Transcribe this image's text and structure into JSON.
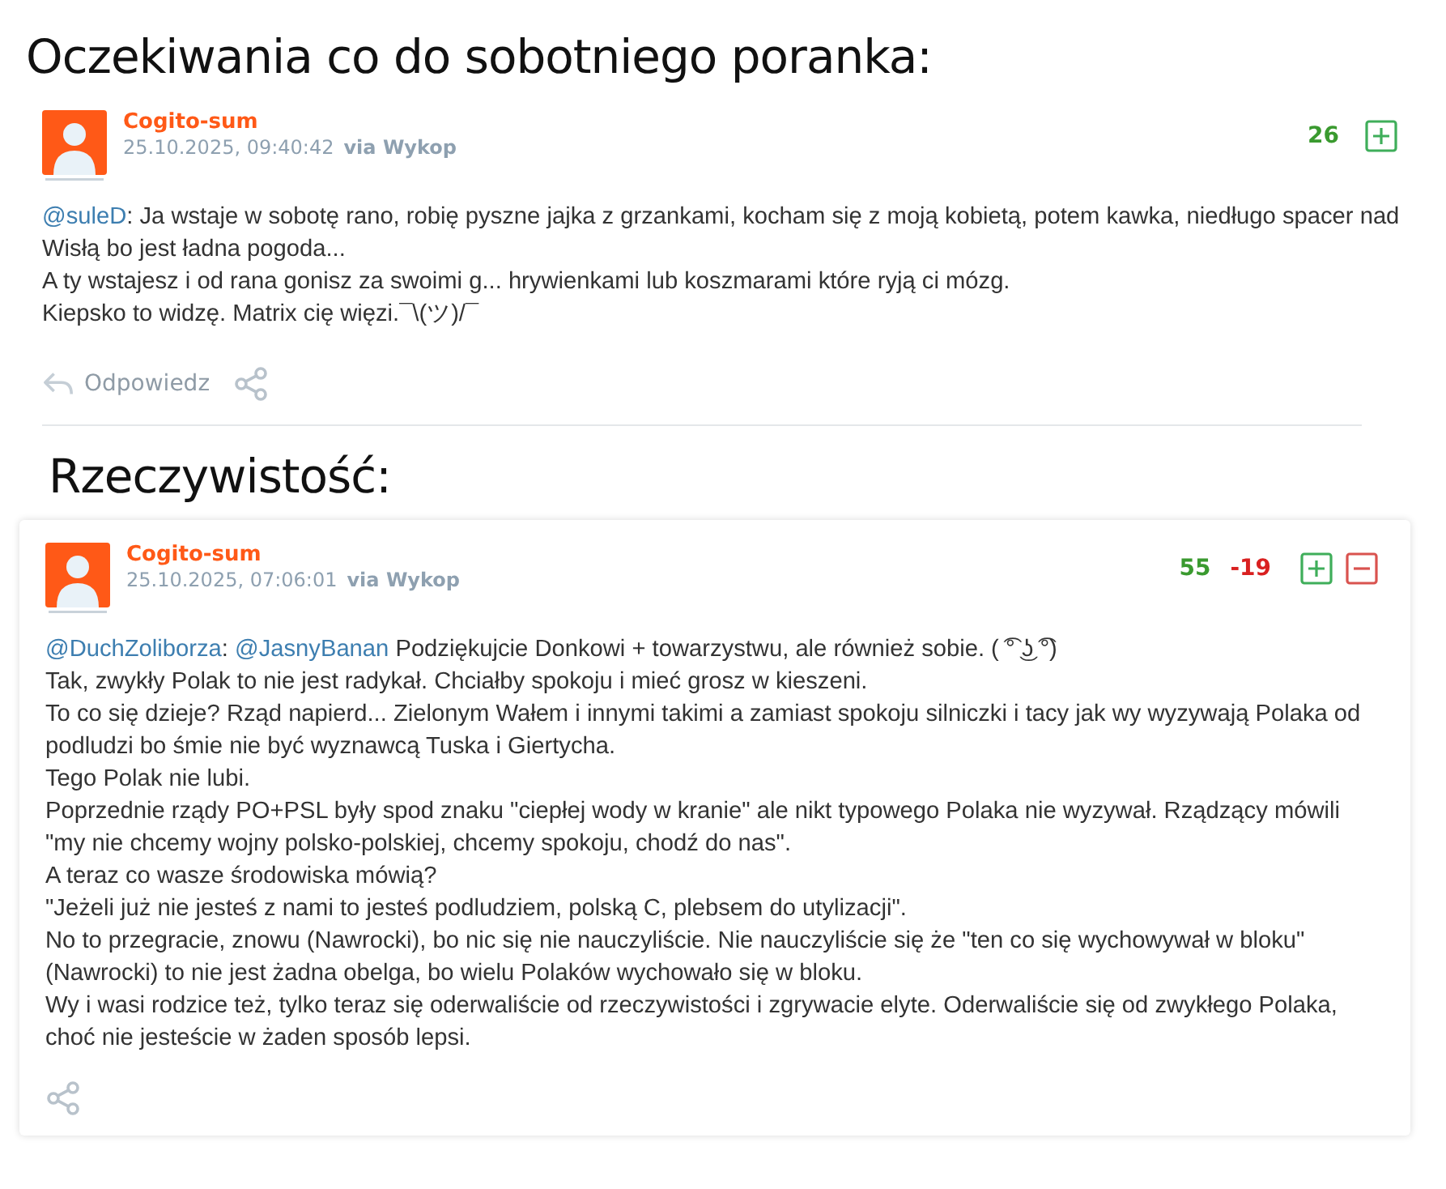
{
  "sections": [
    {
      "heading": "Oczekiwania co do sobotniego poranka:",
      "comment": {
        "card": false,
        "author": "Cogito-sum",
        "date": "25.10.2025, 09:40:42",
        "via": "via Wykop",
        "votes": [
          {
            "kind": "plus_count",
            "text": "26"
          }
        ],
        "vote_buttons": [
          {
            "kind": "plus"
          }
        ],
        "lines": [
          [
            {
              "kind": "mention",
              "text": "@suleD"
            },
            {
              "kind": "text",
              "text": ": Ja wstaje w sobotę rano, robię pyszne jajka z grzankami, kocham się z moją kobietą, potem kawka, niedługo spacer nad Wisłą bo jest ładna pogoda..."
            }
          ],
          [
            {
              "kind": "text",
              "text": "A ty wstajesz i od rana gonisz za swoimi g... hrywienkami lub koszmarami które ryją ci mózg."
            }
          ],
          [
            {
              "kind": "text",
              "text": "Kiepsko to widzę. Matrix cię więzi.¯\\(ツ)/¯"
            }
          ]
        ],
        "actions": [
          {
            "kind": "reply",
            "label": "Odpowiedz"
          },
          {
            "kind": "share"
          }
        ]
      }
    },
    {
      "heading": "Rzeczywistość:",
      "comment": {
        "card": true,
        "author": "Cogito-sum",
        "date": "25.10.2025, 07:06:01",
        "via": "via Wykop",
        "votes": [
          {
            "kind": "plus_count",
            "text": "55"
          },
          {
            "kind": "minus_count",
            "text": "-19"
          }
        ],
        "vote_buttons": [
          {
            "kind": "plus"
          },
          {
            "kind": "minus"
          }
        ],
        "lines": [
          [
            {
              "kind": "mention",
              "text": "@DuchZoliborza"
            },
            {
              "kind": "text",
              "text": ": "
            },
            {
              "kind": "mention",
              "text": "@JasnyBanan"
            },
            {
              "kind": "text",
              "text": " Podziękujcie Donkowi + towarzystwu, ale również sobie. ( ͡° ͜ʖ ͡°)"
            }
          ],
          [
            {
              "kind": "text",
              "text": "Tak, zwykły Polak to nie jest radykał. Chciałby spokoju i mieć grosz w kieszeni."
            }
          ],
          [
            {
              "kind": "text",
              "text": "To co się dzieje? Rząd napierd... Zielonym Wałem i innymi takimi a zamiast spokoju silniczki i tacy jak wy wyzywają Polaka od podludzi bo śmie nie być wyznawcą Tuska i Giertycha."
            }
          ],
          [
            {
              "kind": "text",
              "text": "Tego Polak nie lubi."
            }
          ],
          [
            {
              "kind": "text",
              "text": "Poprzednie rządy PO+PSL były spod znaku \"ciepłej wody w kranie\" ale nikt typowego Polaka nie wyzywał. Rządzący mówili \"my nie chcemy wojny polsko-polskiej, chcemy spokoju, chodź do nas\"."
            }
          ],
          [
            {
              "kind": "text",
              "text": "A teraz co wasze środowiska mówią?"
            }
          ],
          [
            {
              "kind": "text",
              "text": "\"Jeżeli już nie jesteś z nami to jesteś podludziem, polską C, plebsem do utylizacji\"."
            }
          ],
          [
            {
              "kind": "text",
              "text": "No to przegracie, znowu (Nawrocki), bo nic się nie nauczyliście. Nie nauczyliście się że \"ten co się wychowywał w bloku\" (Nawrocki) to nie jest żadna obelga, bo wielu Polaków wychowało się w bloku."
            }
          ],
          [
            {
              "kind": "text",
              "text": "Wy i wasi rodzice też, tylko teraz się oderwaliście od rzeczywistości i zgrywacie elyte. Oderwaliście się od zwykłego Polaka, choć nie jesteście w żaden sposób lepsi."
            }
          ]
        ],
        "actions": [
          {
            "kind": "share"
          }
        ]
      }
    }
  ]
}
